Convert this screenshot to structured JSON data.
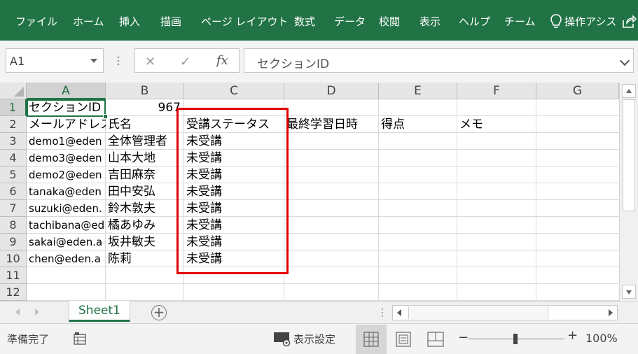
{
  "ribbon": {
    "tabs": [
      "ファイル",
      "ホーム",
      "挿入",
      "描画",
      "ページ レイアウト",
      "数式",
      "データ",
      "校閲",
      "表示",
      "ヘルプ",
      "チーム",
      "操作アシス"
    ]
  },
  "formula_bar": {
    "name_box": "A1",
    "cancel_glyph": "✕",
    "enter_glyph": "✓",
    "fx_label": "fx",
    "content": "セクションID"
  },
  "grid": {
    "columns": [
      "A",
      "B",
      "C",
      "D",
      "E",
      "F",
      "G"
    ],
    "rows": [
      "1",
      "2",
      "3",
      "4",
      "5",
      "6",
      "7",
      "8",
      "9",
      "10",
      "11",
      "12"
    ],
    "row1": {
      "a": "セクションID",
      "b": "967"
    },
    "headers": [
      "メールアドレス",
      "氏名",
      "受講ステータス",
      "最終学習日時",
      "得点",
      "メモ"
    ],
    "data": [
      {
        "email": "demo1@eden",
        "name": "全体管理者",
        "status": "未受講"
      },
      {
        "email": "demo3@eden",
        "name": "山本大地",
        "status": "未受講"
      },
      {
        "email": "demo2@eden",
        "name": "吉田麻奈",
        "status": "未受講"
      },
      {
        "email": "tanaka@eden",
        "name": "田中安弘",
        "status": "未受講"
      },
      {
        "email": "suzuki@eden.",
        "name": "鈴木敦夫",
        "status": "未受講"
      },
      {
        "email": "tachibana@ed",
        "name": "橘あゆみ",
        "status": "未受講"
      },
      {
        "email": "sakai@eden.a",
        "name": "坂井敏夫",
        "status": "未受講"
      },
      {
        "email": "chen@eden.a",
        "name": "陈莉",
        "status": "未受講"
      }
    ]
  },
  "sheets": {
    "active": "Sheet1",
    "add_glyph": "+"
  },
  "status_bar": {
    "ready": "準備完了",
    "display_settings": "表示設定",
    "zoom_minus": "−",
    "zoom_plus": "+",
    "zoom": "100%",
    "zoom_value": 100
  },
  "colors": {
    "accent": "#217346",
    "highlight": "#e30000"
  }
}
